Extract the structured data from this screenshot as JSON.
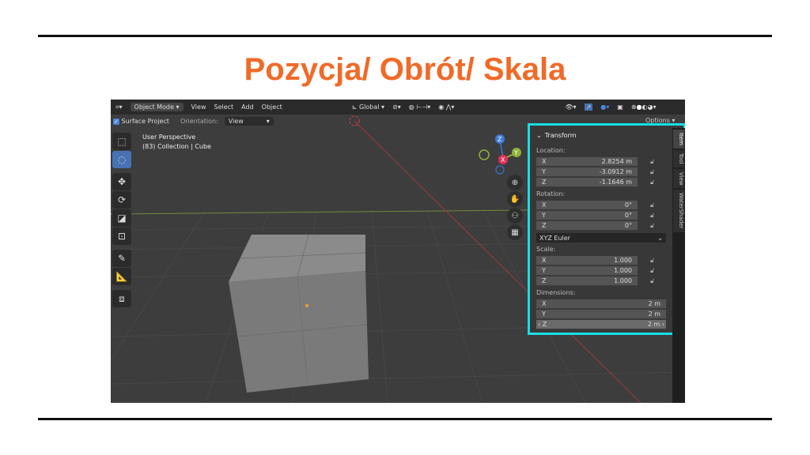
{
  "slide": {
    "title": "Pozycja/ Obrót/ Skala"
  },
  "header": {
    "mode": "Object Mode",
    "menus": [
      "View",
      "Select",
      "Add",
      "Object"
    ],
    "transform_orientation": "Global",
    "options": "Options"
  },
  "toolheader": {
    "surface_project": "Surface Project",
    "orientation_label": "Orientation:",
    "orientation_value": "View"
  },
  "viewport": {
    "view_name": "User Perspective",
    "collection": "(83) Collection | Cube"
  },
  "gizmo": {
    "axes": [
      "X",
      "Y",
      "Z"
    ]
  },
  "sidebar": {
    "tabs": [
      "Item",
      "Tool",
      "View",
      "WaterShader"
    ],
    "panel_title": "Transform",
    "location": {
      "label": "Location:",
      "x": "2.8254 m",
      "y": "-3.0912 m",
      "z": "-1.1646 m"
    },
    "rotation": {
      "label": "Rotation:",
      "x": "0°",
      "y": "0°",
      "z": "0°",
      "mode": "XYZ Euler"
    },
    "scale": {
      "label": "Scale:",
      "x": "1.000",
      "y": "1.000",
      "z": "1.000"
    },
    "dimensions": {
      "label": "Dimensions:",
      "x": "2 m",
      "y": "2 m",
      "z": "2 m"
    },
    "axis_labels": {
      "x": "X",
      "y": "Y",
      "z": "Z"
    }
  },
  "colors": {
    "accent": "#F06A28",
    "highlight": "#17e0e6",
    "active_tool": "#4772b3"
  }
}
